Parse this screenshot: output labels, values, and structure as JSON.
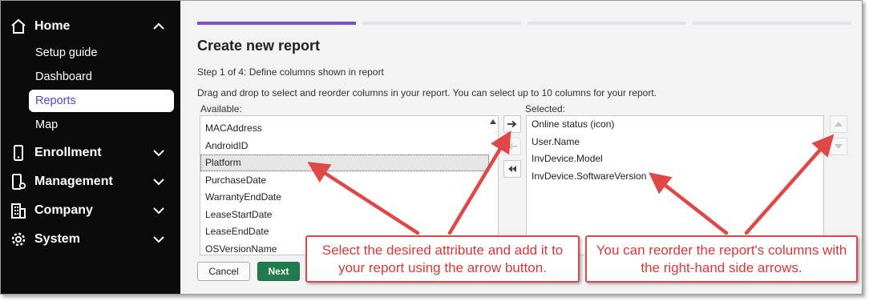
{
  "sidebar": {
    "items": [
      {
        "label": "Home",
        "icon": "home-icon"
      },
      {
        "label": "Enrollment",
        "icon": "phone-icon"
      },
      {
        "label": "Management",
        "icon": "device-gear-icon"
      },
      {
        "label": "Company",
        "icon": "building-icon"
      },
      {
        "label": "System",
        "icon": "gear-icon"
      }
    ],
    "home_sub": [
      "Setup guide",
      "Dashboard",
      "Reports",
      "Map"
    ],
    "active_sub": "Reports"
  },
  "wizard": {
    "title": "Create new report",
    "step_text": "Step 1 of 4: Define columns shown in report",
    "instructions": "Drag and drop to select and reorder columns in your report. You can select up to 10 columns for your report.",
    "available_label": "Available:",
    "selected_label": "Selected:",
    "available": [
      "MACAddress",
      "AndroidID",
      "Platform",
      "PurchaseDate",
      "WarrantyEndDate",
      "LeaseStartDate",
      "LeaseEndDate",
      "OSVersionName"
    ],
    "selected_available": "Platform",
    "selected": [
      "Online status (icon)",
      "User.Name",
      "InvDevice.Model",
      "InvDevice.SoftwareVersion"
    ],
    "cancel_label": "Cancel",
    "next_label": "Next",
    "progress": {
      "current_step": 1,
      "total_steps": 4
    }
  },
  "callouts": {
    "add": "Select the desired attribute and add it to your report using the arrow button.",
    "reorder": "You can reorder the report's columns with the right-hand side arrows."
  },
  "colors": {
    "accent": "#7b4fd6",
    "progress_inactive": "#e3e0ef",
    "next_button": "#227a50",
    "callout": "#e04848",
    "sidebar_bg": "#0b0b0b"
  }
}
